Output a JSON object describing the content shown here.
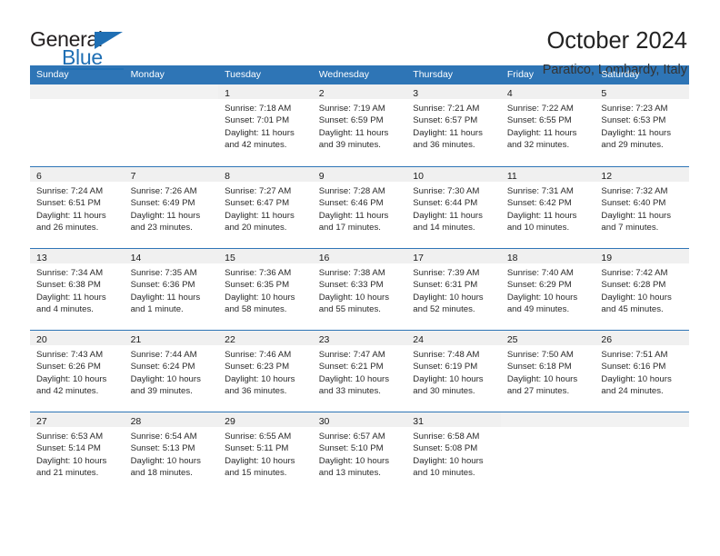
{
  "logo": {
    "word_top": "General",
    "word_bottom": "Blue",
    "triangle_color": "#1f6fb4",
    "text_color": "#231f20"
  },
  "header": {
    "title": "October 2024",
    "subtitle": "Paratico, Lombardy, Italy"
  },
  "theme": {
    "header_blue": "#2e75b6",
    "daynum_band": "#f0f0f0",
    "text": "#2a2a2a"
  },
  "calendar": {
    "day_headers": [
      "Sunday",
      "Monday",
      "Tuesday",
      "Wednesday",
      "Thursday",
      "Friday",
      "Saturday"
    ],
    "weeks": [
      [
        {
          "day": "",
          "sunrise": "",
          "sunset": "",
          "daylight": "",
          "empty": true
        },
        {
          "day": "",
          "sunrise": "",
          "sunset": "",
          "daylight": "",
          "empty": true
        },
        {
          "day": "1",
          "sunrise": "Sunrise: 7:18 AM",
          "sunset": "Sunset: 7:01 PM",
          "daylight1": "Daylight: 11 hours",
          "daylight2": "and 42 minutes."
        },
        {
          "day": "2",
          "sunrise": "Sunrise: 7:19 AM",
          "sunset": "Sunset: 6:59 PM",
          "daylight1": "Daylight: 11 hours",
          "daylight2": "and 39 minutes."
        },
        {
          "day": "3",
          "sunrise": "Sunrise: 7:21 AM",
          "sunset": "Sunset: 6:57 PM",
          "daylight1": "Daylight: 11 hours",
          "daylight2": "and 36 minutes."
        },
        {
          "day": "4",
          "sunrise": "Sunrise: 7:22 AM",
          "sunset": "Sunset: 6:55 PM",
          "daylight1": "Daylight: 11 hours",
          "daylight2": "and 32 minutes."
        },
        {
          "day": "5",
          "sunrise": "Sunrise: 7:23 AM",
          "sunset": "Sunset: 6:53 PM",
          "daylight1": "Daylight: 11 hours",
          "daylight2": "and 29 minutes."
        }
      ],
      [
        {
          "day": "6",
          "sunrise": "Sunrise: 7:24 AM",
          "sunset": "Sunset: 6:51 PM",
          "daylight1": "Daylight: 11 hours",
          "daylight2": "and 26 minutes."
        },
        {
          "day": "7",
          "sunrise": "Sunrise: 7:26 AM",
          "sunset": "Sunset: 6:49 PM",
          "daylight1": "Daylight: 11 hours",
          "daylight2": "and 23 minutes."
        },
        {
          "day": "8",
          "sunrise": "Sunrise: 7:27 AM",
          "sunset": "Sunset: 6:47 PM",
          "daylight1": "Daylight: 11 hours",
          "daylight2": "and 20 minutes."
        },
        {
          "day": "9",
          "sunrise": "Sunrise: 7:28 AM",
          "sunset": "Sunset: 6:46 PM",
          "daylight1": "Daylight: 11 hours",
          "daylight2": "and 17 minutes."
        },
        {
          "day": "10",
          "sunrise": "Sunrise: 7:30 AM",
          "sunset": "Sunset: 6:44 PM",
          "daylight1": "Daylight: 11 hours",
          "daylight2": "and 14 minutes."
        },
        {
          "day": "11",
          "sunrise": "Sunrise: 7:31 AM",
          "sunset": "Sunset: 6:42 PM",
          "daylight1": "Daylight: 11 hours",
          "daylight2": "and 10 minutes."
        },
        {
          "day": "12",
          "sunrise": "Sunrise: 7:32 AM",
          "sunset": "Sunset: 6:40 PM",
          "daylight1": "Daylight: 11 hours",
          "daylight2": "and 7 minutes."
        }
      ],
      [
        {
          "day": "13",
          "sunrise": "Sunrise: 7:34 AM",
          "sunset": "Sunset: 6:38 PM",
          "daylight1": "Daylight: 11 hours",
          "daylight2": "and 4 minutes."
        },
        {
          "day": "14",
          "sunrise": "Sunrise: 7:35 AM",
          "sunset": "Sunset: 6:36 PM",
          "daylight1": "Daylight: 11 hours",
          "daylight2": "and 1 minute."
        },
        {
          "day": "15",
          "sunrise": "Sunrise: 7:36 AM",
          "sunset": "Sunset: 6:35 PM",
          "daylight1": "Daylight: 10 hours",
          "daylight2": "and 58 minutes."
        },
        {
          "day": "16",
          "sunrise": "Sunrise: 7:38 AM",
          "sunset": "Sunset: 6:33 PM",
          "daylight1": "Daylight: 10 hours",
          "daylight2": "and 55 minutes."
        },
        {
          "day": "17",
          "sunrise": "Sunrise: 7:39 AM",
          "sunset": "Sunset: 6:31 PM",
          "daylight1": "Daylight: 10 hours",
          "daylight2": "and 52 minutes."
        },
        {
          "day": "18",
          "sunrise": "Sunrise: 7:40 AM",
          "sunset": "Sunset: 6:29 PM",
          "daylight1": "Daylight: 10 hours",
          "daylight2": "and 49 minutes."
        },
        {
          "day": "19",
          "sunrise": "Sunrise: 7:42 AM",
          "sunset": "Sunset: 6:28 PM",
          "daylight1": "Daylight: 10 hours",
          "daylight2": "and 45 minutes."
        }
      ],
      [
        {
          "day": "20",
          "sunrise": "Sunrise: 7:43 AM",
          "sunset": "Sunset: 6:26 PM",
          "daylight1": "Daylight: 10 hours",
          "daylight2": "and 42 minutes."
        },
        {
          "day": "21",
          "sunrise": "Sunrise: 7:44 AM",
          "sunset": "Sunset: 6:24 PM",
          "daylight1": "Daylight: 10 hours",
          "daylight2": "and 39 minutes."
        },
        {
          "day": "22",
          "sunrise": "Sunrise: 7:46 AM",
          "sunset": "Sunset: 6:23 PM",
          "daylight1": "Daylight: 10 hours",
          "daylight2": "and 36 minutes."
        },
        {
          "day": "23",
          "sunrise": "Sunrise: 7:47 AM",
          "sunset": "Sunset: 6:21 PM",
          "daylight1": "Daylight: 10 hours",
          "daylight2": "and 33 minutes."
        },
        {
          "day": "24",
          "sunrise": "Sunrise: 7:48 AM",
          "sunset": "Sunset: 6:19 PM",
          "daylight1": "Daylight: 10 hours",
          "daylight2": "and 30 minutes."
        },
        {
          "day": "25",
          "sunrise": "Sunrise: 7:50 AM",
          "sunset": "Sunset: 6:18 PM",
          "daylight1": "Daylight: 10 hours",
          "daylight2": "and 27 minutes."
        },
        {
          "day": "26",
          "sunrise": "Sunrise: 7:51 AM",
          "sunset": "Sunset: 6:16 PM",
          "daylight1": "Daylight: 10 hours",
          "daylight2": "and 24 minutes."
        }
      ],
      [
        {
          "day": "27",
          "sunrise": "Sunrise: 6:53 AM",
          "sunset": "Sunset: 5:14 PM",
          "daylight1": "Daylight: 10 hours",
          "daylight2": "and 21 minutes."
        },
        {
          "day": "28",
          "sunrise": "Sunrise: 6:54 AM",
          "sunset": "Sunset: 5:13 PM",
          "daylight1": "Daylight: 10 hours",
          "daylight2": "and 18 minutes."
        },
        {
          "day": "29",
          "sunrise": "Sunrise: 6:55 AM",
          "sunset": "Sunset: 5:11 PM",
          "daylight1": "Daylight: 10 hours",
          "daylight2": "and 15 minutes."
        },
        {
          "day": "30",
          "sunrise": "Sunrise: 6:57 AM",
          "sunset": "Sunset: 5:10 PM",
          "daylight1": "Daylight: 10 hours",
          "daylight2": "and 13 minutes."
        },
        {
          "day": "31",
          "sunrise": "Sunrise: 6:58 AM",
          "sunset": "Sunset: 5:08 PM",
          "daylight1": "Daylight: 10 hours",
          "daylight2": "and 10 minutes."
        },
        {
          "day": "",
          "sunrise": "",
          "sunset": "",
          "daylight1": "",
          "daylight2": "",
          "empty": true
        },
        {
          "day": "",
          "sunrise": "",
          "sunset": "",
          "daylight1": "",
          "daylight2": "",
          "empty": true
        }
      ]
    ]
  }
}
